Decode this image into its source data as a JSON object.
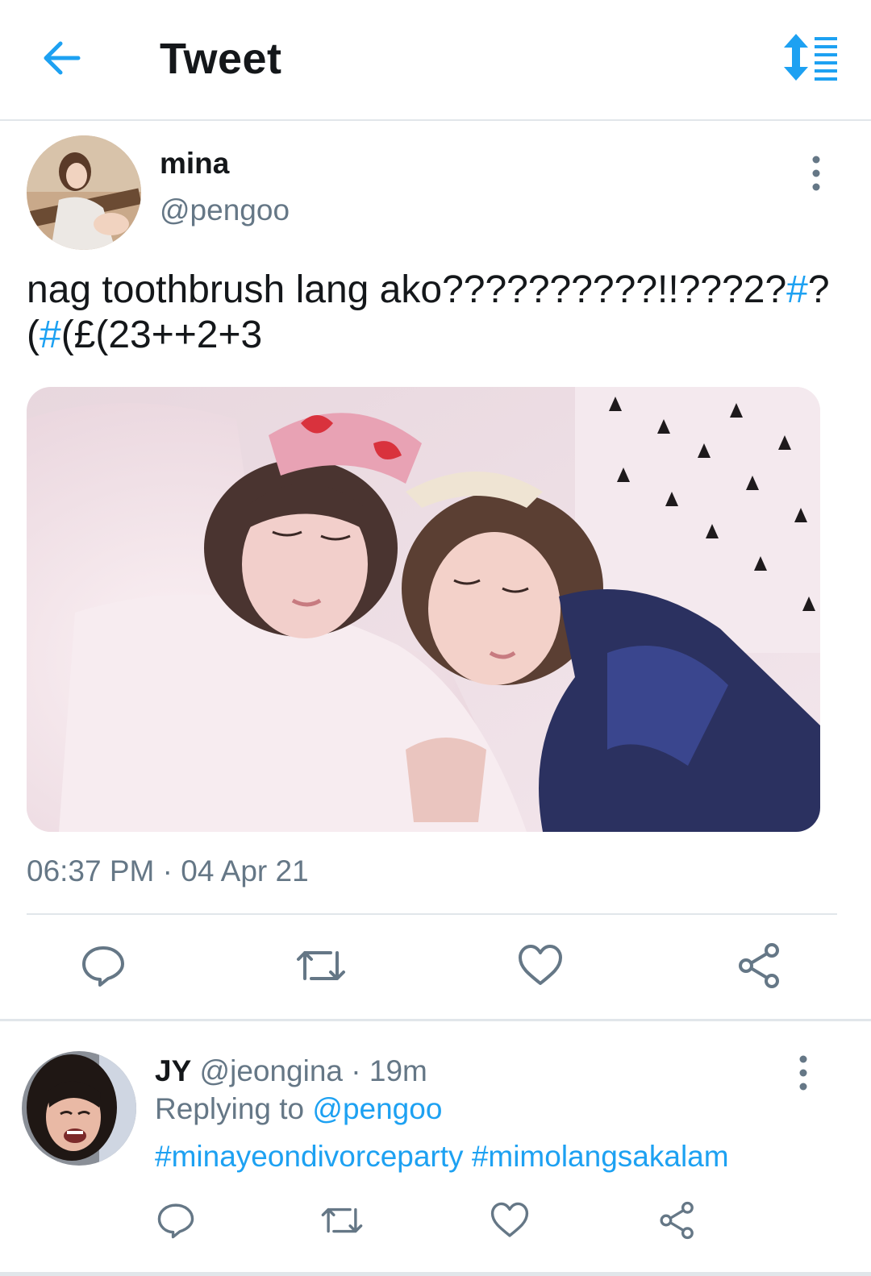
{
  "header": {
    "title": "Tweet",
    "back_icon": "arrow-left-icon",
    "sort_icon": "sort-list-icon"
  },
  "tweet": {
    "author": {
      "name": "mina",
      "handle": "@pengoo"
    },
    "text_parts": [
      "nag toothbrush lang ako??????????!!???2?",
      "#",
      "?",
      "(",
      "#",
      "(£(23++2+3"
    ],
    "media_alt": "Two girls sleeping side by side under a white blanket, one wearing a pink heart sleep mask",
    "timestamp": "06:37 PM · 04 Apr 21",
    "actions": [
      "reply-icon",
      "retweet-icon",
      "like-icon",
      "share-icon"
    ]
  },
  "reply": {
    "name": "JY",
    "handle": "@jeongina",
    "sep": " · ",
    "age": "19m",
    "replying_label": "Replying to ",
    "replying_handle": "@pengoo",
    "text": "#minayeondivorceparty #mimolangsakalam",
    "actions": [
      "reply-icon",
      "retweet-icon",
      "like-icon",
      "share-icon"
    ]
  },
  "colors": {
    "accent": "#1da1f2",
    "text": "#14171a",
    "secondary": "#657786",
    "divider": "#e1e6ea"
  }
}
